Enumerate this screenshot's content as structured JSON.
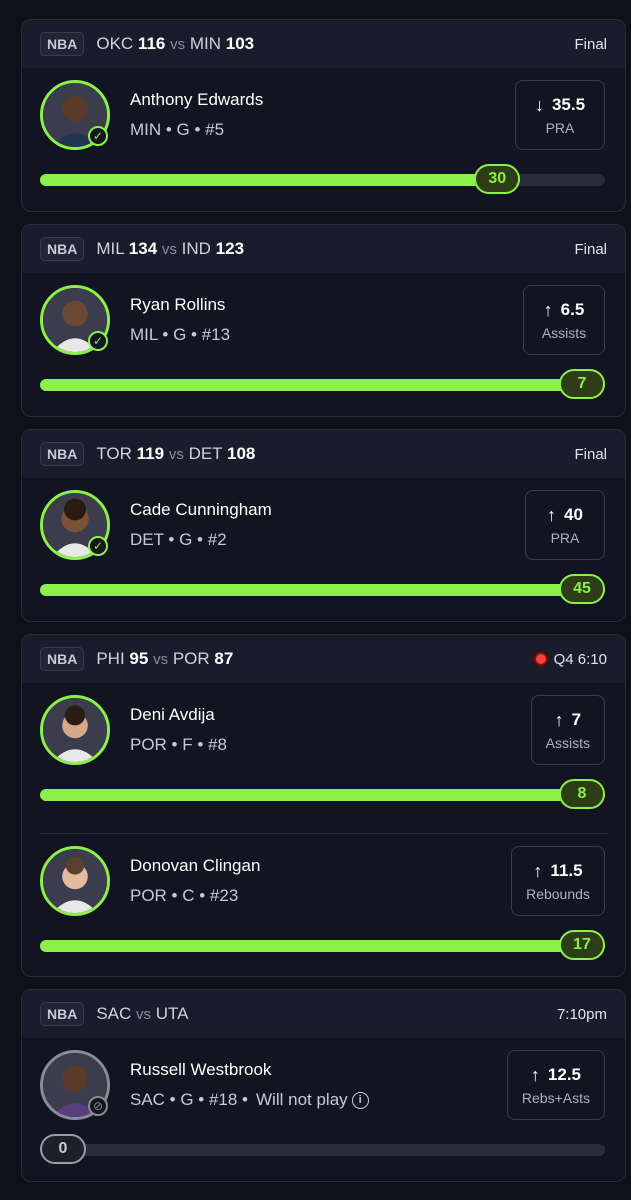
{
  "games": [
    {
      "league": "NBA",
      "away": "OKC",
      "away_score": "116",
      "vs": "vs",
      "home": "MIN",
      "home_score": "103",
      "status": "Final",
      "live": false,
      "players": [
        {
          "name": "Anthony Edwards",
          "info": "MIN • G • #5",
          "direction": "↓",
          "line": "35.5",
          "stat": "PRA",
          "result": "30",
          "progress": 0.85,
          "check": "✓",
          "note": ""
        }
      ]
    },
    {
      "league": "NBA",
      "away": "MIL",
      "away_score": "134",
      "vs": "vs",
      "home": "IND",
      "home_score": "123",
      "status": "Final",
      "live": false,
      "players": [
        {
          "name": "Ryan Rollins",
          "info": "MIL • G • #13",
          "direction": "↑",
          "line": "6.5",
          "stat": "Assists",
          "result": "7",
          "progress": 1.0,
          "check": "✓",
          "note": ""
        }
      ]
    },
    {
      "league": "NBA",
      "away": "TOR",
      "away_score": "119",
      "vs": "vs",
      "home": "DET",
      "home_score": "108",
      "status": "Final",
      "live": false,
      "players": [
        {
          "name": "Cade Cunningham",
          "info": "DET • G • #2",
          "direction": "↑",
          "line": "40",
          "stat": "PRA",
          "result": "45",
          "progress": 1.0,
          "check": "✓",
          "note": ""
        }
      ]
    },
    {
      "league": "NBA",
      "away": "PHI",
      "away_score": "95",
      "vs": "vs",
      "home": "POR",
      "home_score": "87",
      "status": "Q4 6:10",
      "live": true,
      "players": [
        {
          "name": "Deni Avdija",
          "info": "POR • F • #8",
          "direction": "↑",
          "line": "7",
          "stat": "Assists",
          "result": "8",
          "progress": 1.0,
          "check": "",
          "note": ""
        },
        {
          "name": "Donovan Clingan",
          "info": "POR • C • #23",
          "direction": "↑",
          "line": "11.5",
          "stat": "Rebounds",
          "result": "17",
          "progress": 1.0,
          "check": "",
          "note": ""
        }
      ]
    },
    {
      "league": "NBA",
      "away": "SAC",
      "away_score": "",
      "vs": "vs",
      "home": "UTA",
      "home_score": "",
      "status": "7:10pm",
      "live": false,
      "players": [
        {
          "name": "Russell Westbrook",
          "info": "SAC • G • #18 •",
          "direction": "↑",
          "line": "12.5",
          "stat": "Rebs+Asts",
          "result": "0",
          "progress": 0.0,
          "check": "⊘",
          "note": "Will not play",
          "info_icon": "i"
        }
      ]
    }
  ],
  "colors": {
    "accent": "#8cf04a",
    "live": "#ff3b3b",
    "card": "#131421",
    "header": "#1b1c2b"
  }
}
